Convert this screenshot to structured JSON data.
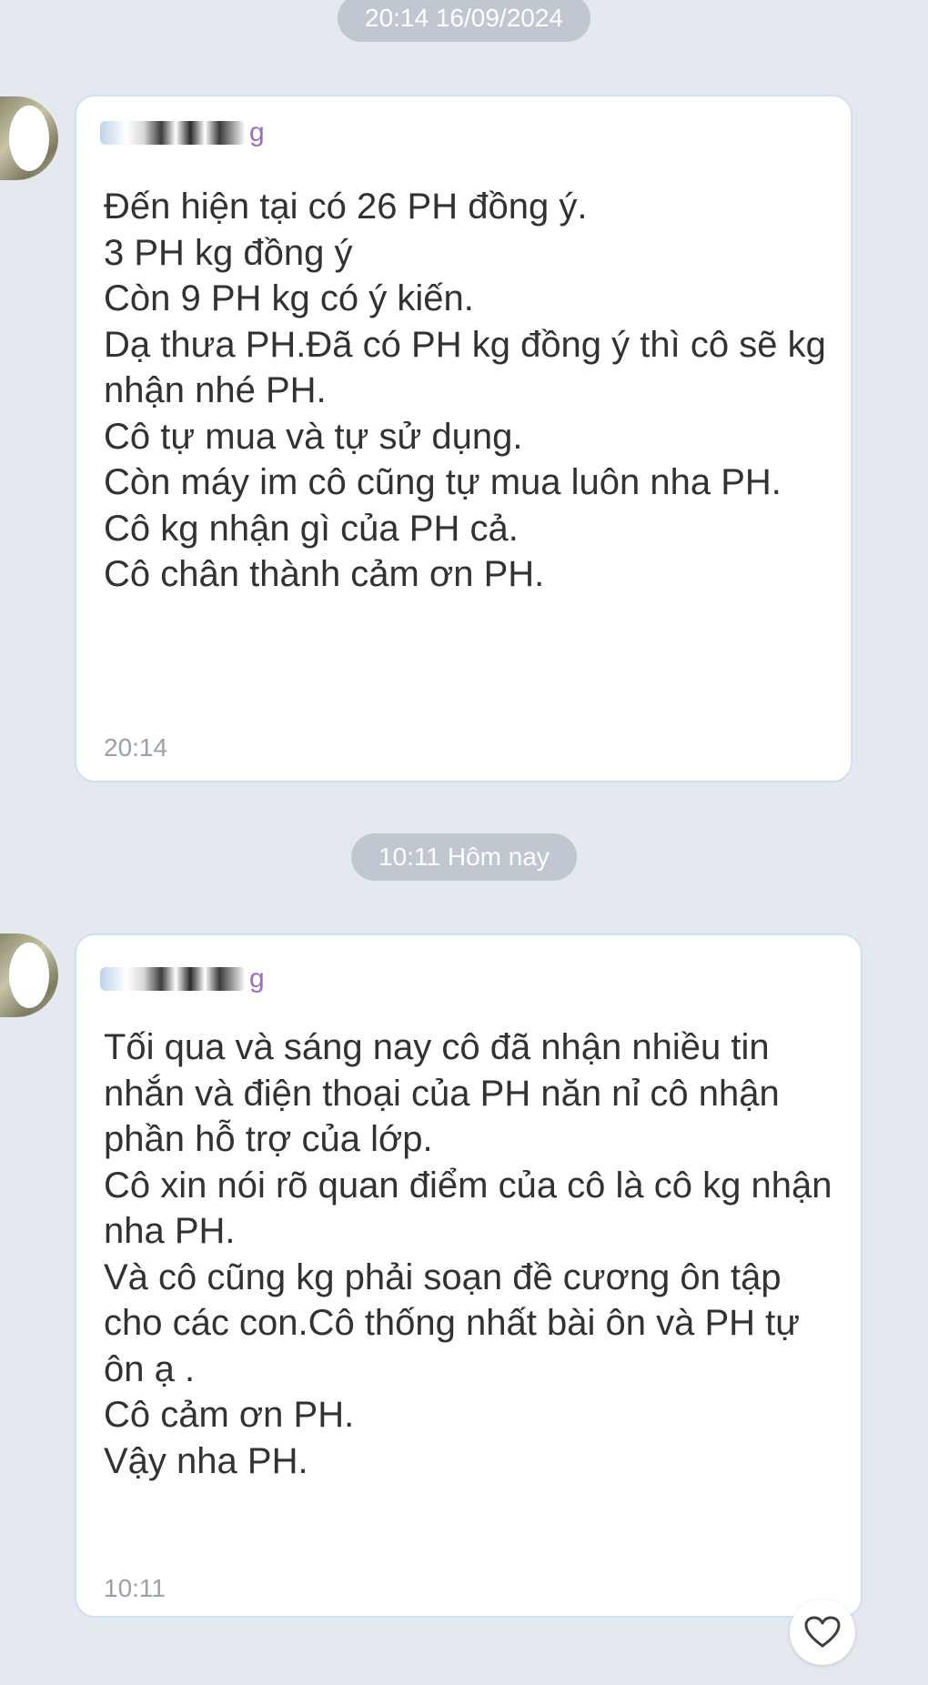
{
  "dividers": {
    "first": "20:14 16/09/2024",
    "second": "10:11 Hôm nay"
  },
  "messages": [
    {
      "sender_suffix": "g",
      "text": "Đến hiện tại có 26 PH đồng ý.\n3 PH kg đồng ý\nCòn 9 PH kg có ý kiến.\nDạ thưa PH.Đã có PH kg đồng ý thì cô sẽ kg nhận nhé PH.\nCô tự mua và tự sử dụng.\nCòn máy im cô cũng tự mua luôn nha PH.\nCô kg nhận gì của PH cả.\nCô chân thành cảm ơn PH.",
      "time": "20:14"
    },
    {
      "sender_suffix": "g",
      "text": "Tối qua và sáng nay cô đã nhận nhiều tin nhắn và điện thoại của PH năn nỉ cô nhận phần hỗ trợ của lớp.\nCô xin nói rõ quan điểm của cô là cô kg nhận nha PH.\nVà cô cũng kg phải soạn đề cương ôn tập cho các con.Cô thống nhất bài ôn và PH tự ôn ạ .\nCô cảm ơn PH.\nVậy nha PH.",
      "time": "10:11"
    }
  ],
  "icons": {
    "heart": "heart-icon"
  },
  "colors": {
    "background": "#e4e8ef",
    "bubble_border": "#cfe0f2",
    "divider_bg": "#c1c7d0",
    "text": "#303236",
    "time": "#9aa1aa"
  }
}
